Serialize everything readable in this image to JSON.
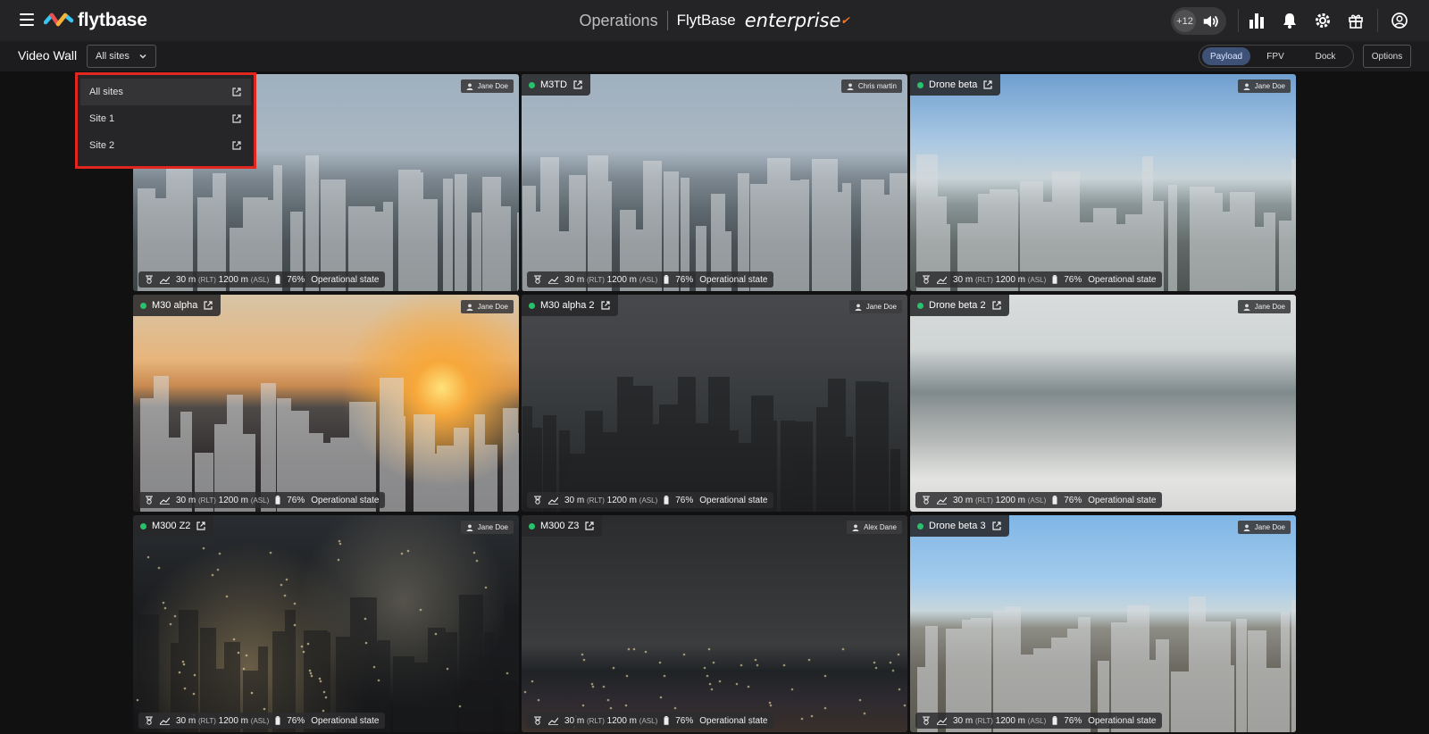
{
  "app": {
    "logo_text": "flytbase",
    "center_title": "Operations",
    "brand": "FlytBase",
    "edition": "enterprise",
    "counter": "+12"
  },
  "toolbar": {
    "page_title": "Video Wall",
    "site_filter_value": "All sites",
    "view_modes": [
      "Payload",
      "FPV",
      "Dock"
    ],
    "active_view_mode": "Payload",
    "options_label": "Options"
  },
  "site_dropdown": {
    "items": [
      "All sites",
      "Site 1",
      "Site 2"
    ],
    "selected": "All sites"
  },
  "tiles": [
    {
      "name": "",
      "status_color": "#27c26b",
      "user": "Jane Doe",
      "altitude_rlt": "30 m",
      "rlt_label": "(RLT)",
      "altitude_asl": "1200 m",
      "asl_label": "(ASL)",
      "battery": "76%",
      "state": "Operational state",
      "scene": "day-city"
    },
    {
      "name": "M3TD",
      "status_color": "#27c26b",
      "user": "Chris martin",
      "altitude_rlt": "30 m",
      "rlt_label": "(RLT)",
      "altitude_asl": "1200 m",
      "asl_label": "(ASL)",
      "battery": "76%",
      "state": "Operational state",
      "scene": "day-city"
    },
    {
      "name": "Drone beta",
      "status_color": "#27c26b",
      "user": "Jane Doe",
      "altitude_rlt": "30 m",
      "rlt_label": "(RLT)",
      "altitude_asl": "1200 m",
      "asl_label": "(ASL)",
      "battery": "76%",
      "state": "Operational state",
      "scene": "bright-city"
    },
    {
      "name": "M30 alpha",
      "status_color": "#27c26b",
      "user": "Jane Doe",
      "altitude_rlt": "30 m",
      "rlt_label": "(RLT)",
      "altitude_asl": "1200 m",
      "asl_label": "(ASL)",
      "battery": "76%",
      "state": "Operational state",
      "scene": "sunset"
    },
    {
      "name": "M30 alpha 2",
      "status_color": "#27c26b",
      "user": "Jane Doe",
      "altitude_rlt": "30 m",
      "rlt_label": "(RLT)",
      "altitude_asl": "1200 m",
      "asl_label": "(ASL)",
      "battery": "76%",
      "state": "Operational state",
      "scene": "dusk-city"
    },
    {
      "name": "Drone beta 2",
      "status_color": "#27c26b",
      "user": "Jane Doe",
      "altitude_rlt": "30 m",
      "rlt_label": "(RLT)",
      "altitude_asl": "1200 m",
      "asl_label": "(ASL)",
      "battery": "76%",
      "state": "Operational state",
      "scene": "rooftop"
    },
    {
      "name": "M300 Z2",
      "status_color": "#27c26b",
      "user": "Jane Doe",
      "altitude_rlt": "30 m",
      "rlt_label": "(RLT)",
      "altitude_asl": "1200 m",
      "asl_label": "(ASL)",
      "battery": "76%",
      "state": "Operational state",
      "scene": "night-lights"
    },
    {
      "name": "M300 Z3",
      "status_color": "#27c26b",
      "user": "Alex Dane",
      "altitude_rlt": "30 m",
      "rlt_label": "(RLT)",
      "altitude_asl": "1200 m",
      "asl_label": "(ASL)",
      "battery": "76%",
      "state": "Operational state",
      "scene": "night-sky"
    },
    {
      "name": "Drone beta 3",
      "status_color": "#27c26b",
      "user": "Jane Doe",
      "altitude_rlt": "30 m",
      "rlt_label": "(RLT)",
      "altitude_asl": "1200 m",
      "asl_label": "(ASL)",
      "battery": "76%",
      "state": "Operational state",
      "scene": "wide-city"
    }
  ],
  "icons": {
    "menu": "hamburger-icon",
    "audio": "speaker-icon",
    "analytics": "bar-chart-icon",
    "notifications": "bell-icon",
    "settings": "gear-icon",
    "whats_new": "gift-icon",
    "account": "user-circle-icon"
  }
}
